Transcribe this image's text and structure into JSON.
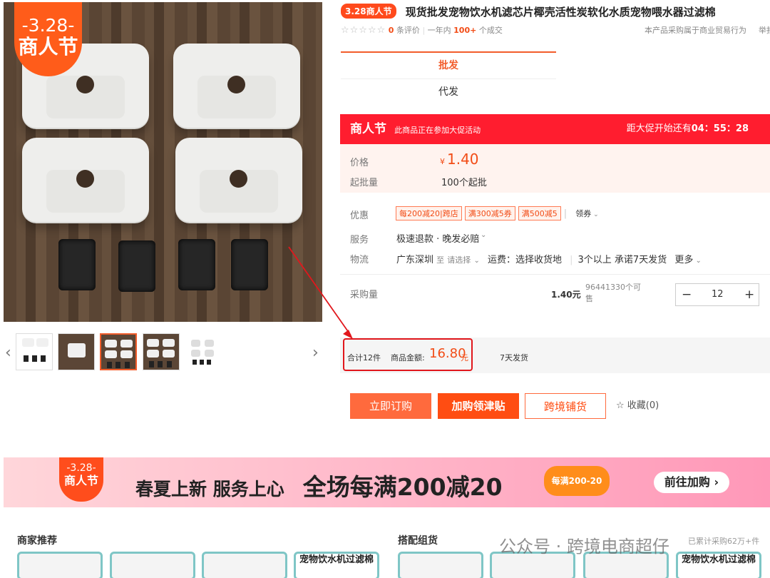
{
  "gallery": {
    "badge_date": "-3.28-",
    "badge_text": "商人节",
    "thumb_prev": "‹",
    "thumb_next": "›"
  },
  "product": {
    "tag": "3.28商人节",
    "title": "现货批发宠物饮水机滤芯片椰壳活性炭软化水质宠物喂水器过滤棉",
    "stars": "☆☆☆☆☆",
    "review_count": "0",
    "review_suffix": "条评价",
    "year_label": "一年内",
    "sold_count": "100+",
    "sold_suffix": "个成交",
    "business_note": "本产品采购属于商业贸易行为",
    "report": "举报"
  },
  "tabs": [
    {
      "label": "批发"
    },
    {
      "label": "代发"
    }
  ],
  "promo": {
    "brand": "商人节",
    "subtitle": "此商品正在参加大促活动",
    "countdown_label": "距大促开始还有",
    "countdown": "04：55：28"
  },
  "pricing": {
    "price_label": "价格",
    "price_symbol": "¥",
    "price": "1.40",
    "moq_label": "起批量",
    "moq": "100个起批"
  },
  "details": {
    "offer_label": "优惠",
    "coupons": [
      "每200减20|跨店",
      "满300减5券",
      "满500减5"
    ],
    "coupon_link": "领券",
    "service_label": "服务",
    "service": "极速退款 · 晚发必赔",
    "logistics_label": "物流",
    "origin": "广东深圳",
    "to": "至",
    "choose": "请选择",
    "freight": "运费：选择收货地",
    "delivery": "3个以上 承诺7天发货",
    "more": "更多"
  },
  "purchase": {
    "label": "采购量",
    "unit_price": "1.40元",
    "stock": "96441330个可售",
    "quantity": "12",
    "minus": "−",
    "plus": "+"
  },
  "summary": {
    "count": "合计12件",
    "amount_label": "商品金额:",
    "amount": "16.80",
    "currency": "元",
    "shipping": "7天发货"
  },
  "buttons": {
    "order": "立即订购",
    "cart": "加购领津贴",
    "crossborder": "跨境铺货",
    "favorite": "收藏(0)"
  },
  "banner": {
    "date": "-3.28-",
    "badge": "商人节",
    "text1": "春夏上新 服务上心",
    "text2": "全场每满200减20",
    "coupon": "每满200-20",
    "cta": "前往加购"
  },
  "recommend": {
    "merchant_title": "商家推荐",
    "combo_title": "搭配组货",
    "card_text": "宠物饮水机过滤棉",
    "sold_note": "已累计采购62万+件"
  },
  "watermark": "公众号 · 跨境电商超仔",
  "colors": {
    "accent": "#f24c16",
    "promo": "#ff1d2f",
    "highlight": "#e1171c"
  }
}
